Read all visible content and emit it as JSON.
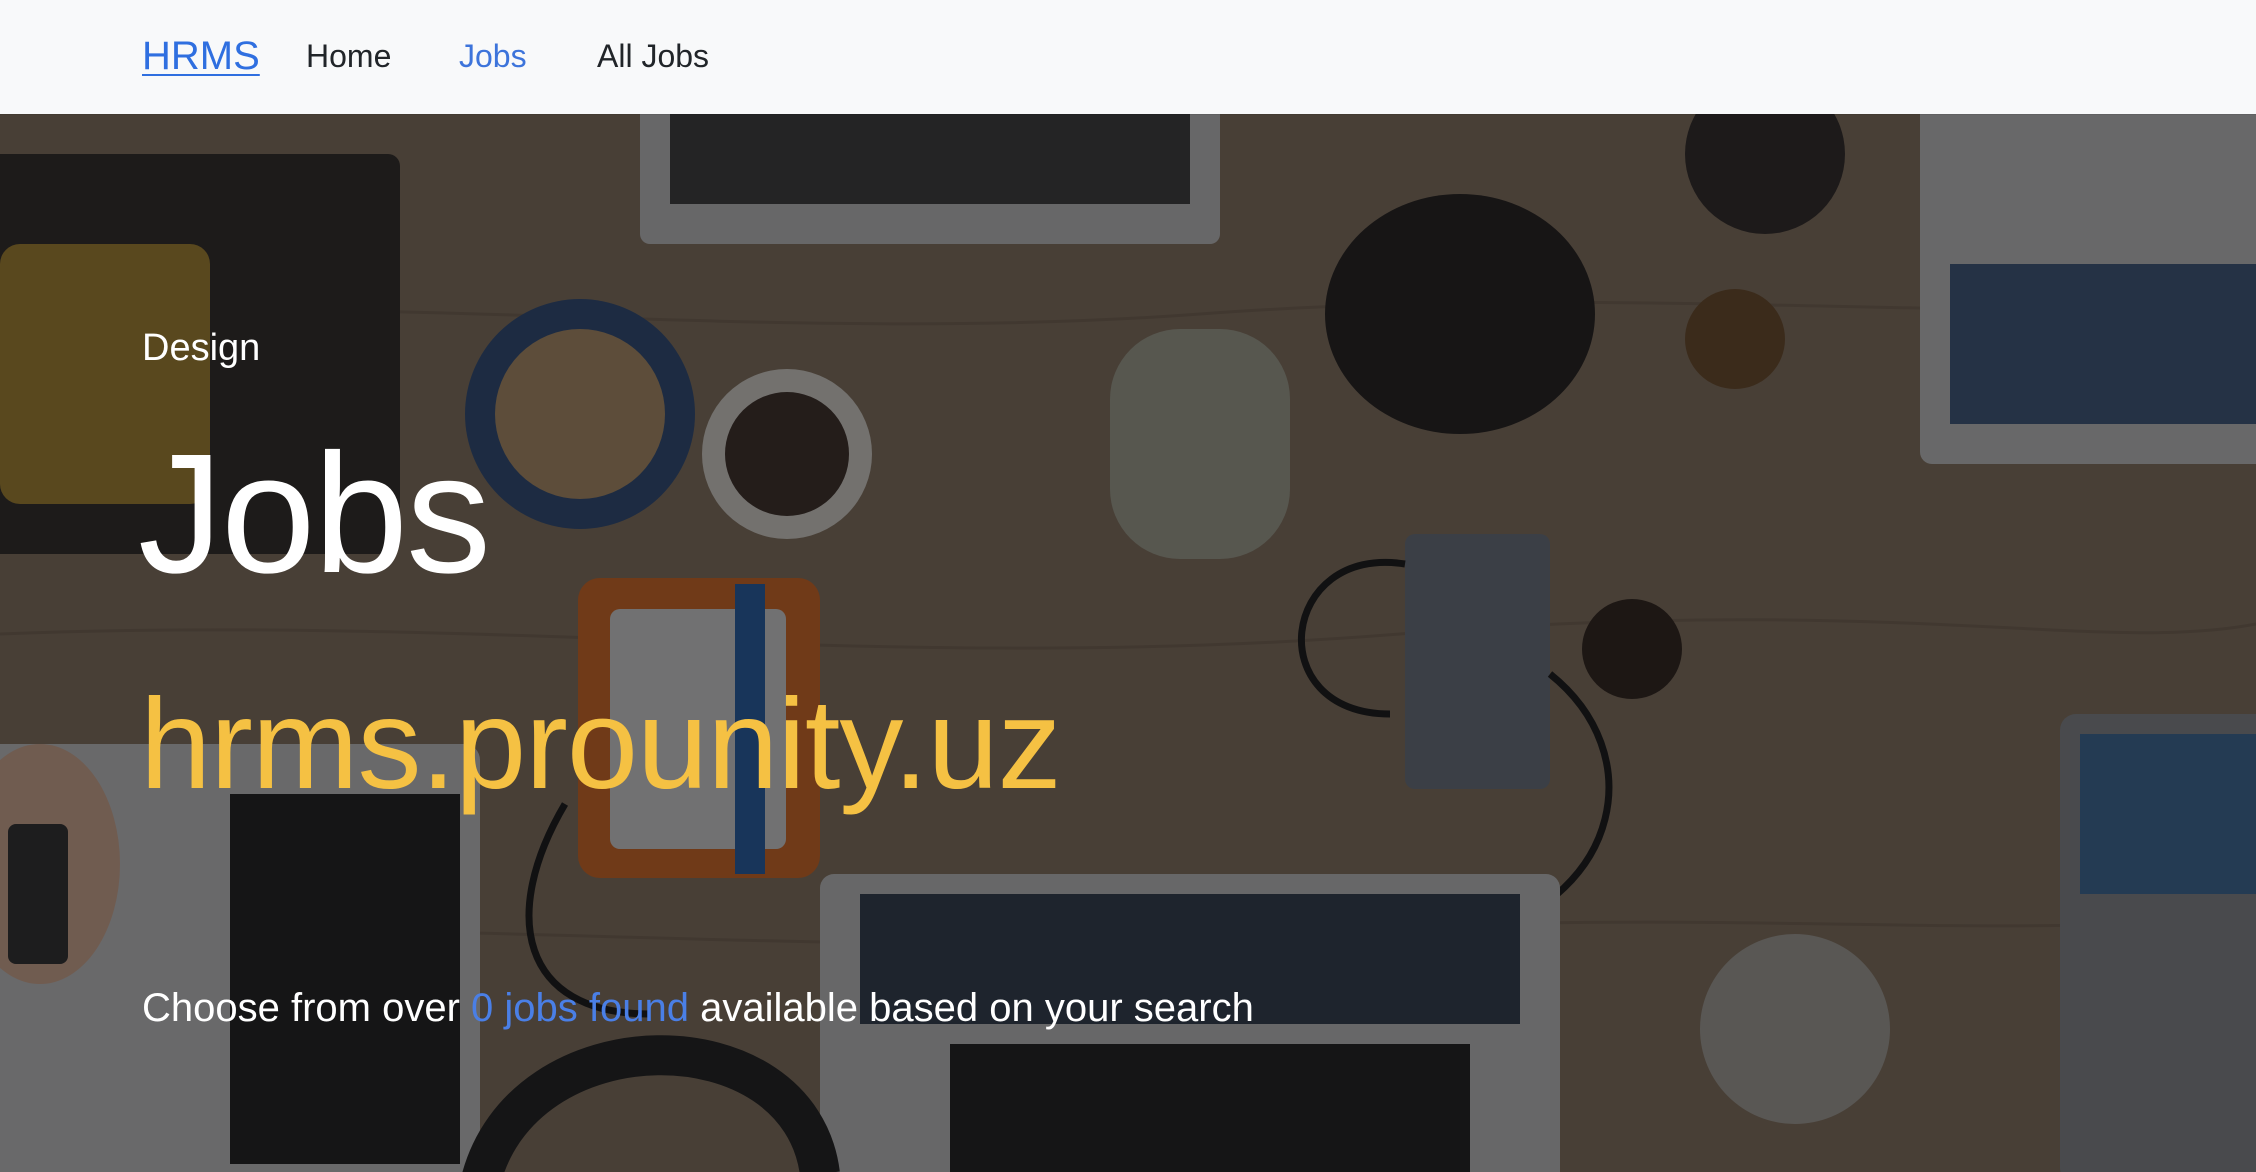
{
  "navbar": {
    "brand": "HRMS",
    "links": [
      {
        "label": "Home",
        "active": false
      },
      {
        "label": "Jobs",
        "active": true
      },
      {
        "label": "All Jobs",
        "active": false
      }
    ]
  },
  "hero": {
    "eyebrow": "Design",
    "title": "Jobs",
    "domain": "hrms.prounity.uz",
    "lead_prefix": "Choose from over",
    "lead_count": "0 jobs found",
    "lead_suffix": "available based on your search"
  },
  "colors": {
    "accent": "#3d74db",
    "highlight": "#f5c143",
    "navbar_bg": "#f8f9fa"
  }
}
